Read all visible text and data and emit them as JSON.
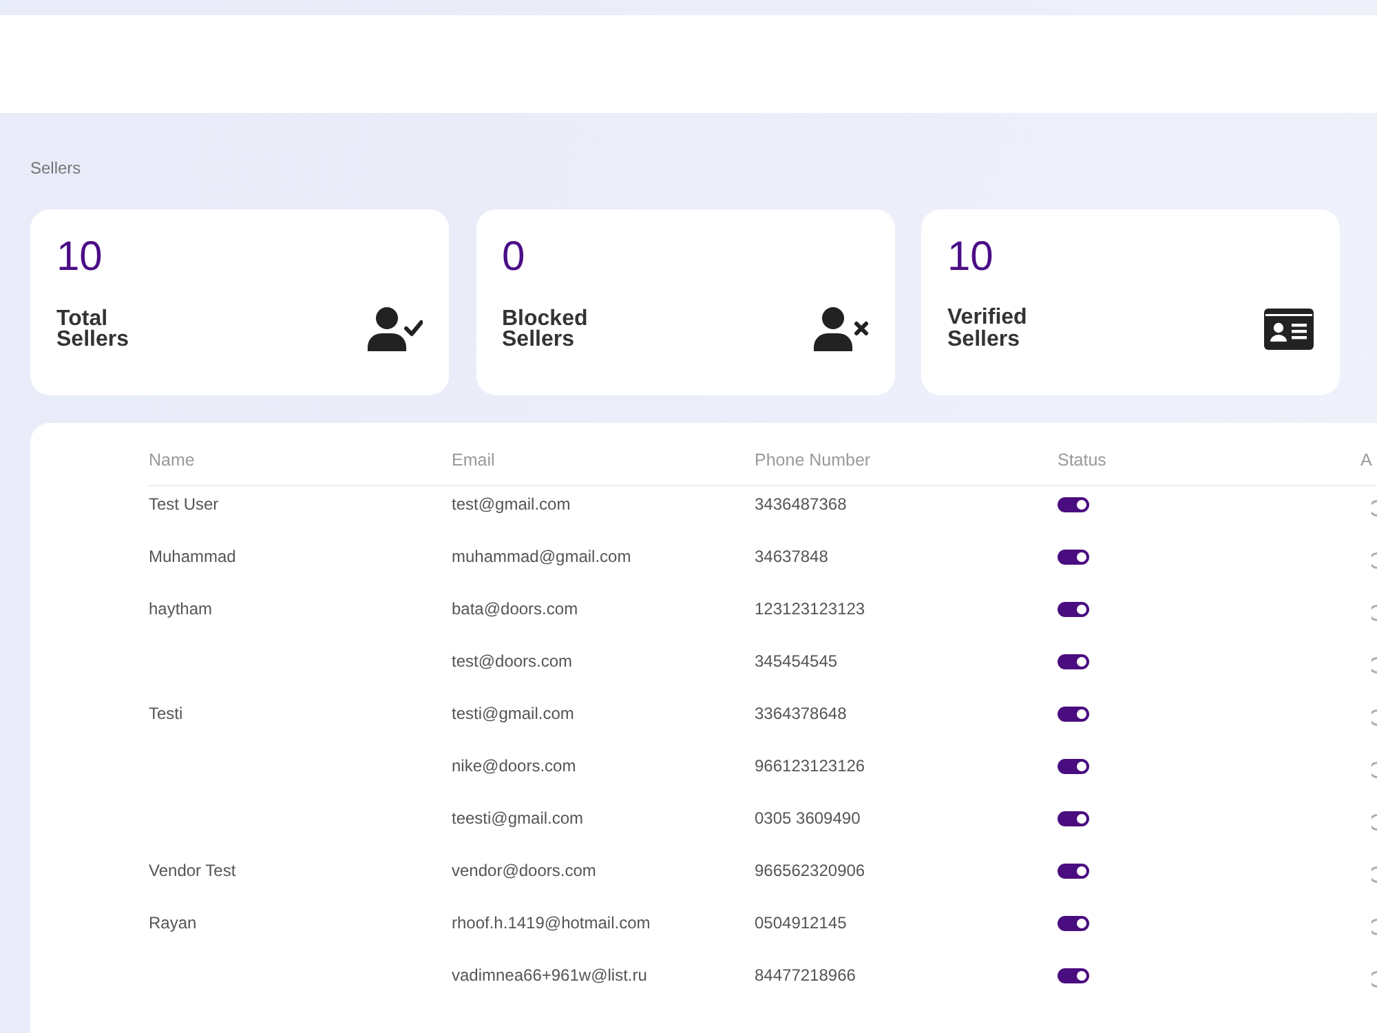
{
  "breadcrumb": "Sellers",
  "stats": [
    {
      "value": "10",
      "label": "Total Sellers",
      "kind": "usercheck"
    },
    {
      "value": "0",
      "label": "Blocked Sellers",
      "kind": "userx"
    },
    {
      "value": "10",
      "label": "Verified Sellers",
      "kind": "idcard"
    }
  ],
  "table": {
    "columns": [
      "Name",
      "Email",
      "Phone Number",
      "Status",
      "A"
    ],
    "rows": [
      {
        "name": "Test User",
        "email": "test@gmail.com",
        "phone": "3436487368",
        "on": true
      },
      {
        "name": "Muhammad",
        "email": "muhammad@gmail.com",
        "phone": "34637848",
        "on": true
      },
      {
        "name": "haytham",
        "email": "bata@doors.com",
        "phone": "123123123123",
        "on": true
      },
      {
        "email": "test@doors.com",
        "phone": "345454545",
        "on": true
      },
      {
        "name": "Testi",
        "email": "testi@gmail.com",
        "phone": "3364378648",
        "on": true
      },
      {
        "email": "nike@doors.com",
        "phone": "966123123126",
        "on": true
      },
      {
        "email": "teesti@gmail.com",
        "phone": "0305 3609490",
        "on": true
      },
      {
        "name": "Vendor Test",
        "email": "vendor@doors.com",
        "phone": "966562320906",
        "on": true
      },
      {
        "name": "Rayan",
        "email": "rhoof.h.1419@hotmail.com",
        "phone": "0504912145",
        "on": true
      },
      {
        "email": "vadimnea66+961w@list.ru",
        "phone": "84477218966",
        "on": true
      }
    ]
  }
}
